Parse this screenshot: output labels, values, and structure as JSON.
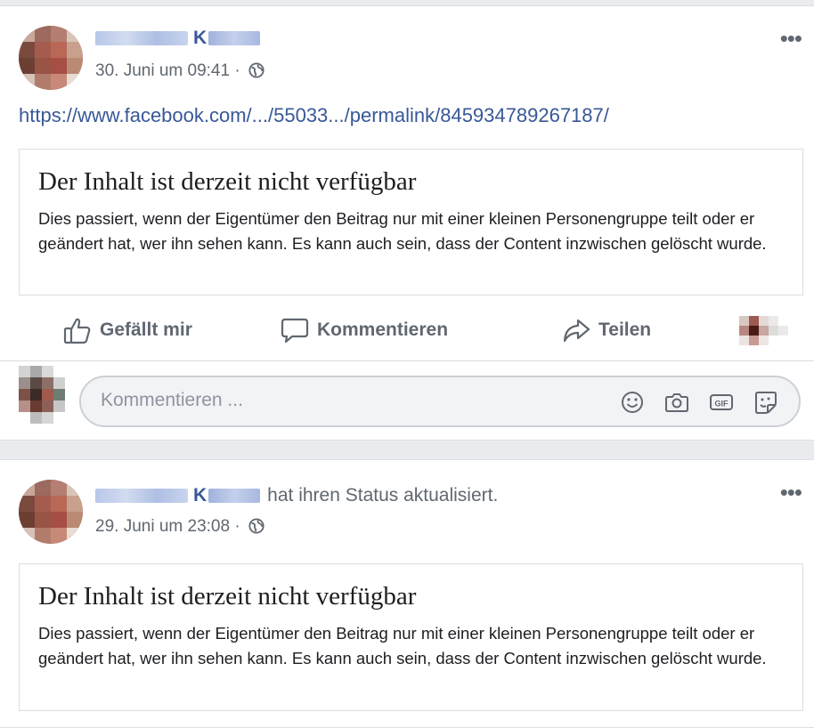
{
  "posts": [
    {
      "author_initial": "K",
      "timestamp": "30. Juni um 09:41 ·",
      "link": "https://www.facebook.com/.../55033.../permalink/845934789267187/",
      "notice": {
        "title": "Der Inhalt ist derzeit nicht verfügbar",
        "body": "Dies passiert, wenn der Eigentümer den Beitrag nur mit einer kleinen Personengruppe teilt oder er geändert hat, wer ihn sehen kann. Es kann auch sein, dass der Content inzwischen gelöscht wurde."
      },
      "actions": {
        "like": "Gefällt mir",
        "comment": "Kommentieren",
        "share": "Teilen"
      },
      "comment_placeholder": "Kommentieren ...",
      "comment_icons": [
        "emoji-icon",
        "camera-icon",
        "gif-icon",
        "sticker-icon"
      ]
    },
    {
      "author_initial": "K",
      "action_text": "hat ihren Status aktualisiert.",
      "timestamp": "29. Juni um 23:08 ·",
      "notice": {
        "title": "Der Inhalt ist derzeit nicht verfügbar",
        "body": "Dies passiert, wenn der Eigentümer den Beitrag nur mit einer kleinen Personengruppe teilt oder er geändert hat, wer ihn sehen kann. Es kann auch sein, dass der Content inzwischen gelöscht wurde."
      }
    }
  ],
  "more_glyph": "•••",
  "colors": {
    "link": "#385898",
    "meta": "#606770",
    "background": "#e9ebee"
  }
}
